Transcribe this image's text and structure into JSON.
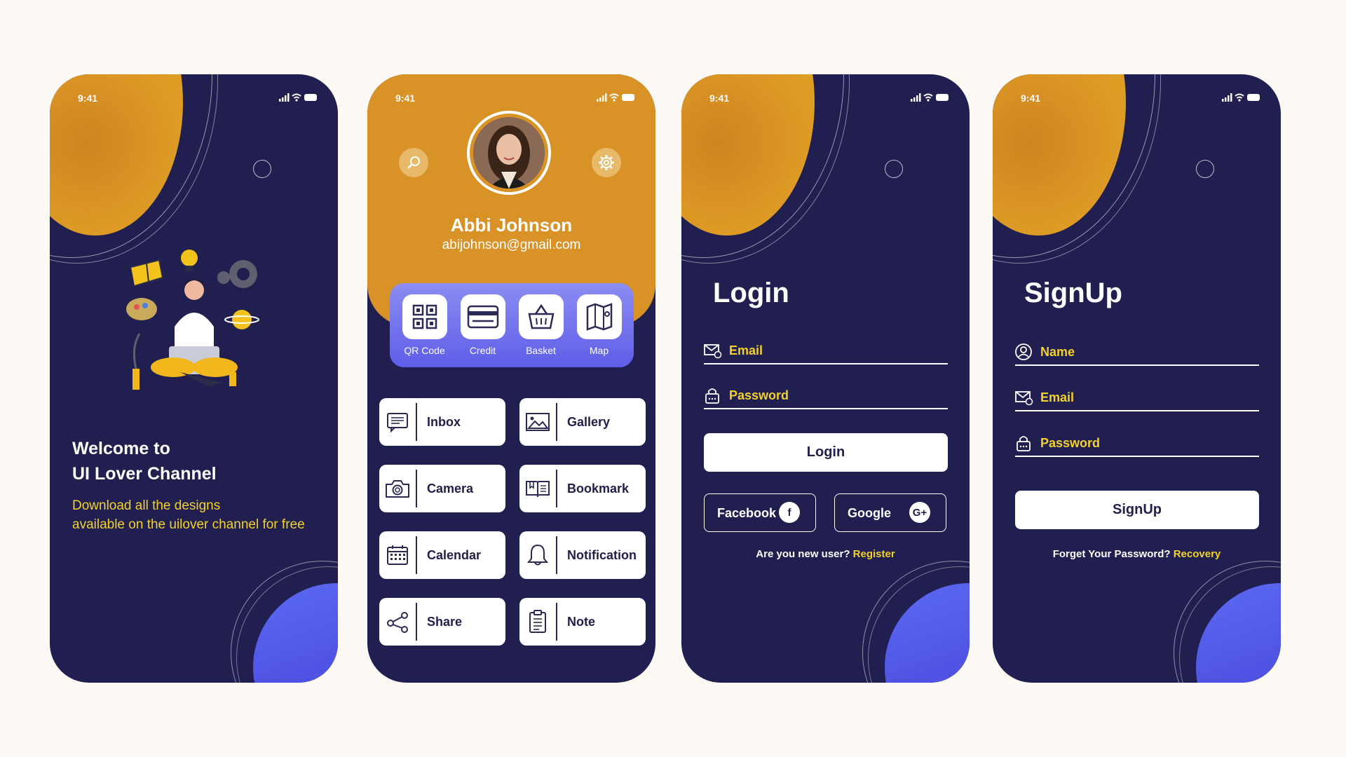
{
  "status_bar": {
    "time": "9:41"
  },
  "welcome": {
    "title_line1": "Welcome to",
    "title_line2": "UI Lover Channel",
    "subtitle_line1": "Download all the designs",
    "subtitle_line2": "available on the uilover channel for free"
  },
  "profile": {
    "name": "Abbi Johnson",
    "email": "abijohnson@gmail.com",
    "quick_actions": [
      {
        "label": "QR Code",
        "icon": "qr-code-icon"
      },
      {
        "label": "Credit",
        "icon": "credit-card-icon"
      },
      {
        "label": "Basket",
        "icon": "basket-icon"
      },
      {
        "label": "Map",
        "icon": "map-icon"
      }
    ],
    "menu": [
      {
        "label": "Inbox",
        "icon": "inbox-icon"
      },
      {
        "label": "Gallery",
        "icon": "gallery-icon"
      },
      {
        "label": "Camera",
        "icon": "camera-icon"
      },
      {
        "label": "Bookmark",
        "icon": "bookmark-icon"
      },
      {
        "label": "Calendar",
        "icon": "calendar-icon"
      },
      {
        "label": "Notification",
        "icon": "bell-icon"
      },
      {
        "label": "Share",
        "icon": "share-icon"
      },
      {
        "label": "Note",
        "icon": "note-icon"
      }
    ]
  },
  "login": {
    "title": "Login",
    "email_label": "Email",
    "password_label": "Password",
    "button": "Login",
    "facebook": "Facebook",
    "google": "Google",
    "footer_text": "Are you new user?",
    "footer_link": "Register"
  },
  "signup": {
    "title": "SignUp",
    "name_label": "Name",
    "email_label": "Email",
    "password_label": "Password",
    "button": "SignUp",
    "footer_text": "Forget Your Password?",
    "footer_link": "Recovery"
  },
  "colors": {
    "background": "#fdfaf6",
    "phone": "#201f50",
    "accent_orange": "#d99226",
    "accent_yellow": "#f2d12e",
    "accent_blue": "#5b6af2"
  }
}
